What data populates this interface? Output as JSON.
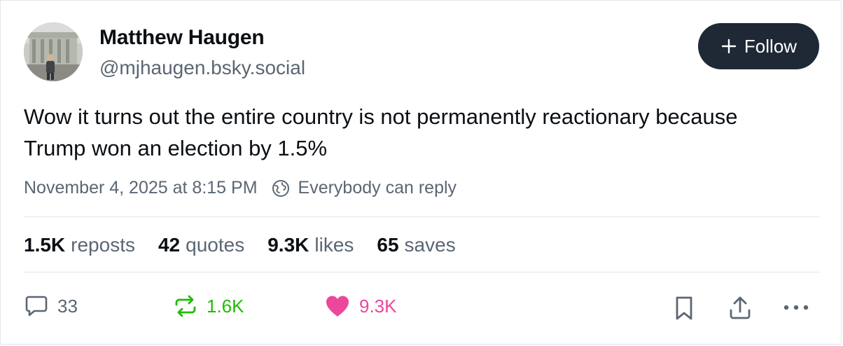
{
  "author": {
    "name": "Matthew Haugen",
    "handle": "@mjhaugen.bsky.social"
  },
  "follow_button": {
    "label": "Follow",
    "icon": "plus-icon"
  },
  "post": {
    "text": "Wow it turns out the entire country is not permanently reactionary because Trump won an election by 1.5%",
    "timestamp": "November 4, 2025 at 8:15 PM",
    "reply_setting": "Everybody can reply"
  },
  "stats": {
    "reposts": {
      "value": "1.5K",
      "label": "reposts"
    },
    "quotes": {
      "value": "42",
      "label": "quotes"
    },
    "likes": {
      "value": "9.3K",
      "label": "likes"
    },
    "saves": {
      "value": "65",
      "label": "saves"
    }
  },
  "actions": {
    "reply": {
      "count": "33",
      "icon": "reply-bubble-icon"
    },
    "repost": {
      "count": "1.6K",
      "icon": "repost-icon",
      "color": "#20bc07"
    },
    "like": {
      "count": "9.3K",
      "icon": "heart-icon",
      "color": "#ec4899"
    },
    "bookmark": {
      "icon": "bookmark-icon"
    },
    "share": {
      "icon": "share-icon"
    },
    "more": {
      "icon": "more-icon"
    }
  },
  "colors": {
    "text_primary": "#0b0f14",
    "text_secondary": "#5b6673",
    "follow_bg": "#1e2935",
    "repost_active": "#20bc07",
    "like_active": "#ec4899"
  }
}
